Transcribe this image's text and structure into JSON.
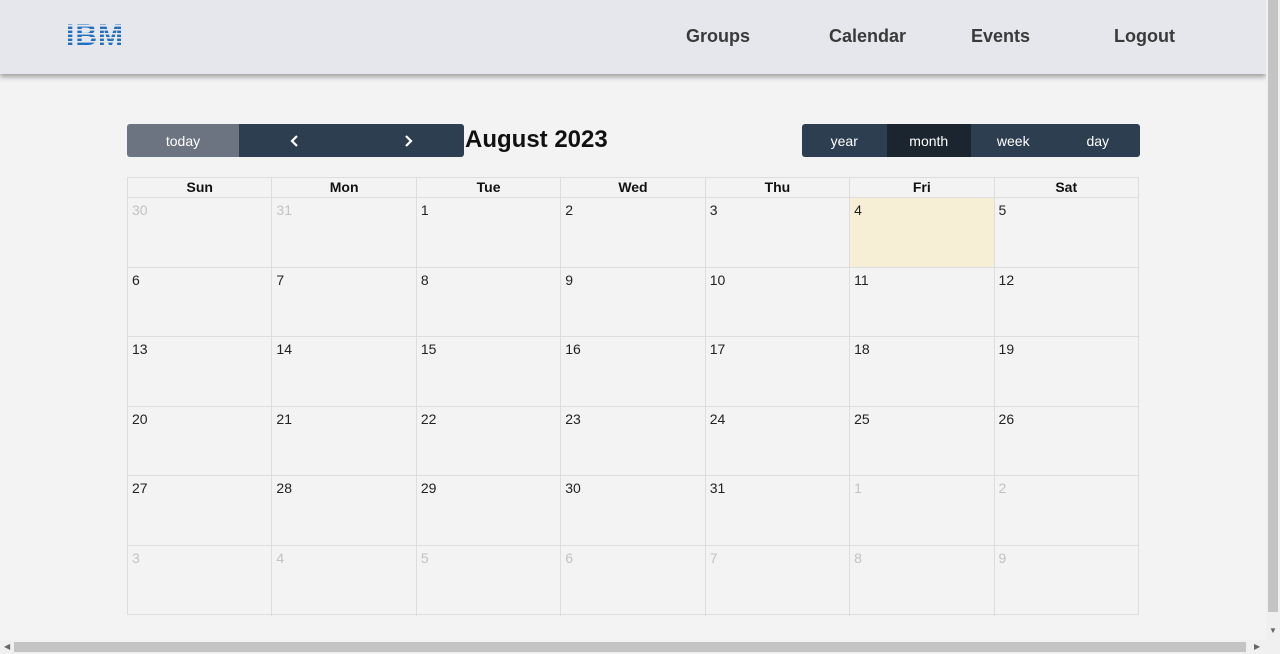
{
  "nav": {
    "logo_text": "IBM",
    "links": [
      "Groups",
      "Calendar",
      "Events",
      "Logout"
    ]
  },
  "toolbar": {
    "today_label": "today",
    "prev_icon": "chevron-left-icon",
    "next_icon": "chevron-right-icon",
    "title": "August 2023",
    "views": [
      "year",
      "month",
      "week",
      "day"
    ],
    "active_view": "month"
  },
  "calendar": {
    "day_headers": [
      "Sun",
      "Mon",
      "Tue",
      "Wed",
      "Thu",
      "Fri",
      "Sat"
    ],
    "weeks": [
      [
        {
          "d": "30",
          "other": true
        },
        {
          "d": "31",
          "other": true
        },
        {
          "d": "1"
        },
        {
          "d": "2"
        },
        {
          "d": "3"
        },
        {
          "d": "4",
          "today": true
        },
        {
          "d": "5"
        }
      ],
      [
        {
          "d": "6"
        },
        {
          "d": "7"
        },
        {
          "d": "8"
        },
        {
          "d": "9"
        },
        {
          "d": "10"
        },
        {
          "d": "11"
        },
        {
          "d": "12"
        }
      ],
      [
        {
          "d": "13"
        },
        {
          "d": "14"
        },
        {
          "d": "15"
        },
        {
          "d": "16"
        },
        {
          "d": "17"
        },
        {
          "d": "18"
        },
        {
          "d": "19"
        }
      ],
      [
        {
          "d": "20"
        },
        {
          "d": "21"
        },
        {
          "d": "22"
        },
        {
          "d": "23"
        },
        {
          "d": "24"
        },
        {
          "d": "25"
        },
        {
          "d": "26"
        }
      ],
      [
        {
          "d": "27"
        },
        {
          "d": "28"
        },
        {
          "d": "29"
        },
        {
          "d": "30"
        },
        {
          "d": "31"
        },
        {
          "d": "1",
          "other": true
        },
        {
          "d": "2",
          "other": true
        }
      ],
      [
        {
          "d": "3",
          "other": true
        },
        {
          "d": "4",
          "other": true
        },
        {
          "d": "5",
          "other": true
        },
        {
          "d": "6",
          "other": true
        },
        {
          "d": "7",
          "other": true
        },
        {
          "d": "8",
          "other": true
        },
        {
          "d": "9",
          "other": true
        }
      ]
    ]
  },
  "colors": {
    "brand": "#1f70c1",
    "toolbar_dark": "#2c3e50",
    "today_highlight": "#f6efd6"
  }
}
